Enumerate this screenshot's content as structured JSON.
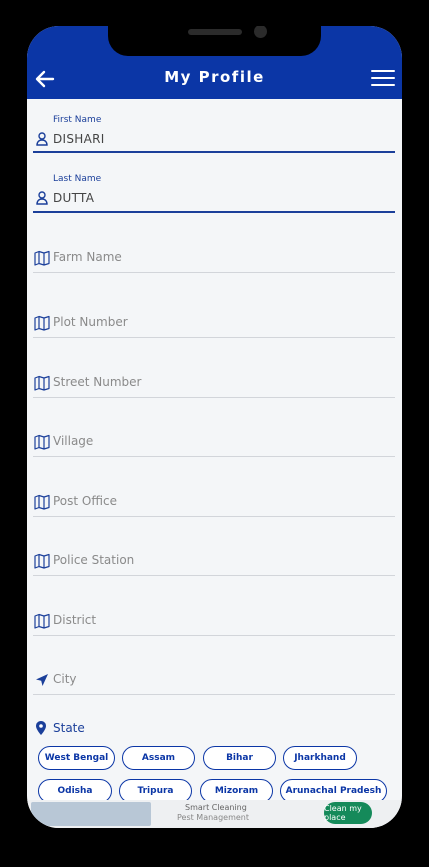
{
  "header": {
    "title": "My Profile"
  },
  "fields": {
    "first_name": {
      "label": "First Name",
      "value": "DISHARI"
    },
    "last_name": {
      "label": "Last Name",
      "value": "DUTTA"
    },
    "farm_name": {
      "placeholder": "Farm Name"
    },
    "plot_number": {
      "placeholder": "Plot Number"
    },
    "street_number": {
      "placeholder": "Street Number"
    },
    "village": {
      "placeholder": "Village"
    },
    "post_office": {
      "placeholder": "Post Office"
    },
    "police_station": {
      "placeholder": "Police Station"
    },
    "district": {
      "placeholder": "District"
    },
    "city": {
      "placeholder": "City"
    }
  },
  "state": {
    "label": "State",
    "options": [
      "West Bengal",
      "Assam",
      "Bihar",
      "Jharkhand",
      "Odisha",
      "Tripura",
      "Mizoram",
      "Arunachal Pradesh"
    ]
  },
  "ad": {
    "line1": "Smart Cleaning",
    "line2": "Pest Management",
    "brand": "Clean my place"
  },
  "colors": {
    "primary": "#0b36a6",
    "background": "#f4f6f8"
  }
}
